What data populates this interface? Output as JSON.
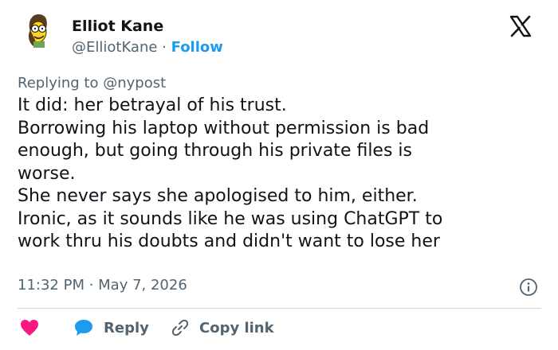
{
  "author": {
    "name": "Elliot Kane",
    "handle": "@ElliotKane",
    "separator": " · ",
    "follow_label": "Follow"
  },
  "reply_context": {
    "prefix": "Replying to ",
    "target": "@nypost"
  },
  "tweet": {
    "lines": [
      "It did: her betrayal of his trust.",
      "Borrowing his laptop without permission is bad",
      "enough, but going through his private files is",
      "worse.",
      "She never says she apologised to him, either.",
      "Ironic, as it sounds like he was using ChatGPT to",
      "work thru his doubts and didn't want to lose her"
    ]
  },
  "timestamp": "11:32 PM · May 7, 2026",
  "actions": {
    "like_icon": "heart-icon",
    "reply_label": "Reply",
    "reply_icon": "speech-bubble-icon",
    "copy_label": "Copy link",
    "copy_icon": "link-icon"
  },
  "colors": {
    "text": "#0f1419",
    "secondary": "#536471",
    "link": "#1d9bf0",
    "like": "#f91880",
    "divider": "#cfd9de"
  }
}
